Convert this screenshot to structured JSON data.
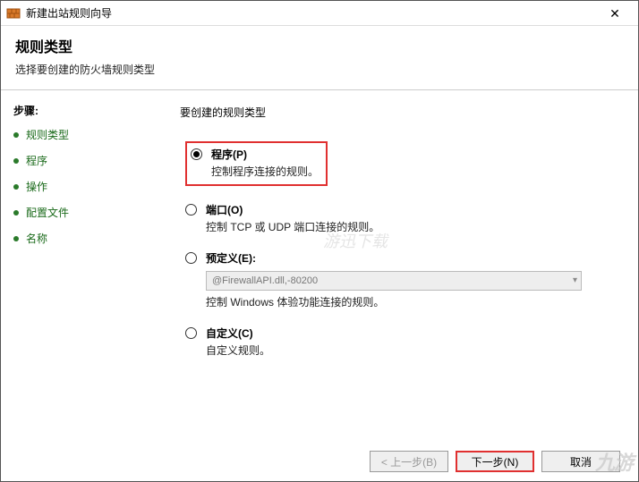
{
  "titlebar": {
    "title": "新建出站规则向导",
    "close": "✕"
  },
  "header": {
    "title": "规则类型",
    "subtitle": "选择要创建的防火墙规则类型"
  },
  "steps_label": "步骤:",
  "steps": [
    {
      "label": "规则类型"
    },
    {
      "label": "程序"
    },
    {
      "label": "操作"
    },
    {
      "label": "配置文件"
    },
    {
      "label": "名称"
    }
  ],
  "question": "要创建的规则类型",
  "options": {
    "program": {
      "label": "程序(P)",
      "desc": "控制程序连接的规则。",
      "selected": true
    },
    "port": {
      "label": "端口(O)",
      "desc": "控制 TCP 或 UDP 端口连接的规则。"
    },
    "predefined": {
      "label": "预定义(E):",
      "combo": "@FirewallAPI.dll,-80200",
      "desc": "控制 Windows 体验功能连接的规则。"
    },
    "custom": {
      "label": "自定义(C)",
      "desc": "自定义规则。"
    }
  },
  "buttons": {
    "back": "< 上一步(B)",
    "next": "下一步(N)",
    "cancel": "取消"
  },
  "watermark_center": "游迅下载",
  "watermark_corner": "九游"
}
